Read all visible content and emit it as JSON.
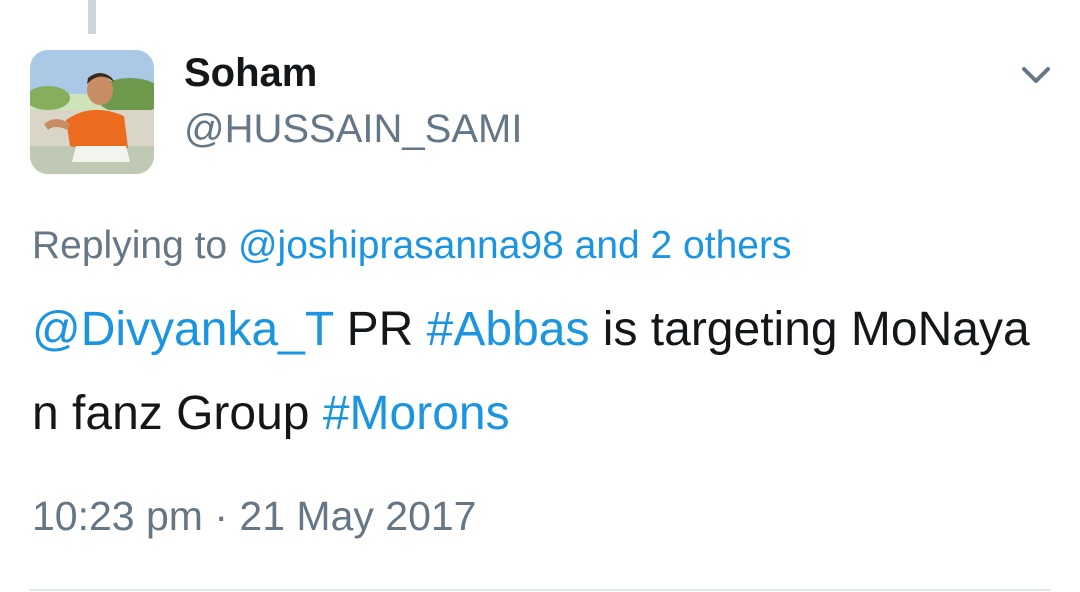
{
  "author": {
    "display_name": "Soham",
    "handle": "@HUSSAIN_SAMI"
  },
  "reply_context": {
    "prefix": "Replying to",
    "mention": "@joshiprasanna98",
    "others": "and 2 others"
  },
  "tweet": {
    "segments": [
      {
        "text": "@Divyanka_T",
        "type": "mention"
      },
      {
        "text": " PR ",
        "type": "plain"
      },
      {
        "text": "#Abbas",
        "type": "hashtag"
      },
      {
        "text": " is targeting MoNaya n fanz Group ",
        "type": "plain"
      },
      {
        "text": "#Morons",
        "type": "hashtag"
      }
    ]
  },
  "meta": {
    "time": "10:23 pm",
    "separator": "·",
    "date": "21 May 2017"
  },
  "colors": {
    "link": "#1b95e0",
    "secondary": "#657786",
    "primary_text": "#14171a"
  },
  "icons": {
    "menu": "chevron-down-icon"
  }
}
